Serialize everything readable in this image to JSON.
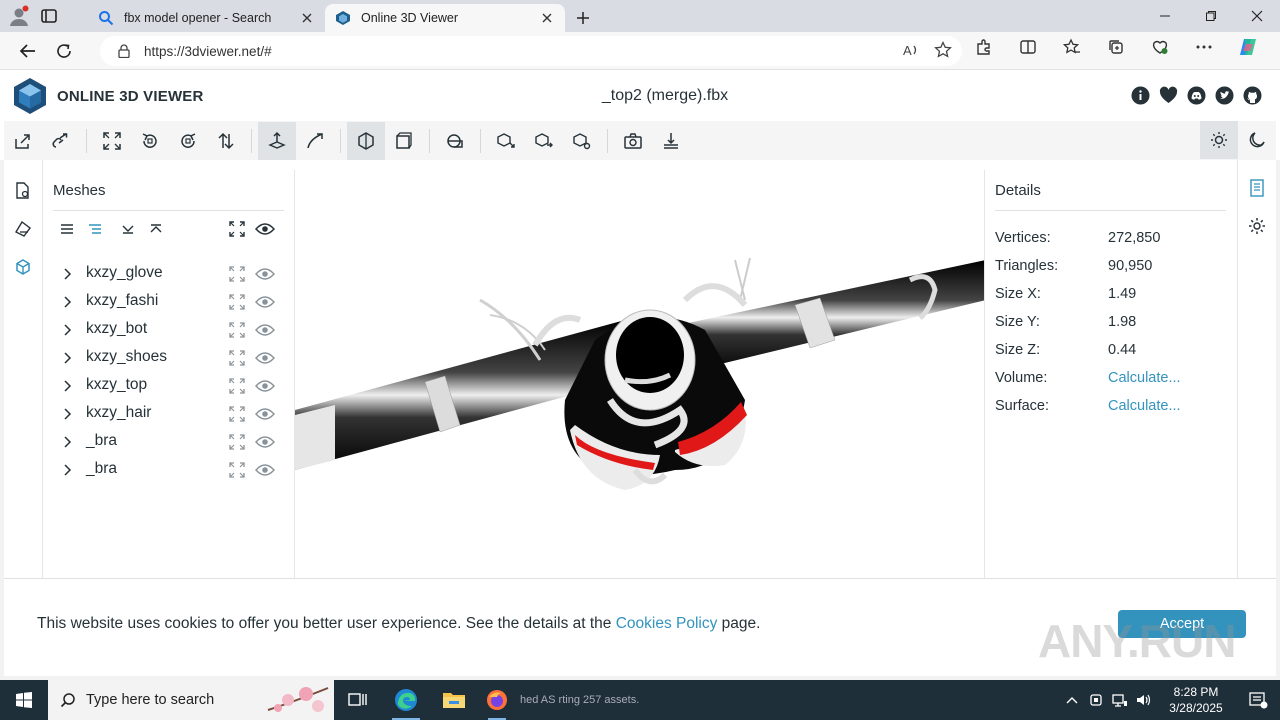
{
  "browser": {
    "tabs": [
      {
        "label": "fbx model opener - Search",
        "active": false
      },
      {
        "label": "Online 3D Viewer",
        "active": true
      }
    ],
    "url": "https://3dviewer.net/#"
  },
  "app": {
    "logo_text": "ONLINE 3D VIEWER",
    "filename": "_top2 (merge).fbx"
  },
  "meshes": {
    "title": "Meshes",
    "items": [
      {
        "name": "kxzy_glove"
      },
      {
        "name": "kxzy_fashi"
      },
      {
        "name": "kxzy_bot"
      },
      {
        "name": "kxzy_shoes"
      },
      {
        "name": "kxzy_top"
      },
      {
        "name": "kxzy_hair"
      },
      {
        "name": "_bra"
      },
      {
        "name": "_bra"
      }
    ]
  },
  "details": {
    "title": "Details",
    "rows": [
      {
        "key": "Vertices:",
        "value": "272,850",
        "link": false
      },
      {
        "key": "Triangles:",
        "value": "90,950",
        "link": false
      },
      {
        "key": "Size X:",
        "value": "1.49",
        "link": false
      },
      {
        "key": "Size Y:",
        "value": "1.98",
        "link": false
      },
      {
        "key": "Size Z:",
        "value": "0.44",
        "link": false
      },
      {
        "key": "Volume:",
        "value": "Calculate...",
        "link": true
      },
      {
        "key": "Surface:",
        "value": "Calculate...",
        "link": true
      }
    ]
  },
  "cookie": {
    "text_before": "This website uses cookies to offer you better user experience. See the details at the ",
    "link": "Cookies Policy",
    "text_after": " page.",
    "accept": "Accept",
    "watermark": "ANY.RUN"
  },
  "taskbar": {
    "search_placeholder": "Type here to search",
    "app_text": "hed  AS  rting 257 assets.",
    "time": "8:28 PM",
    "date": "3/28/2025"
  },
  "colors": {
    "accent": "#3393bd",
    "taskbar": "#1f2f3a"
  }
}
